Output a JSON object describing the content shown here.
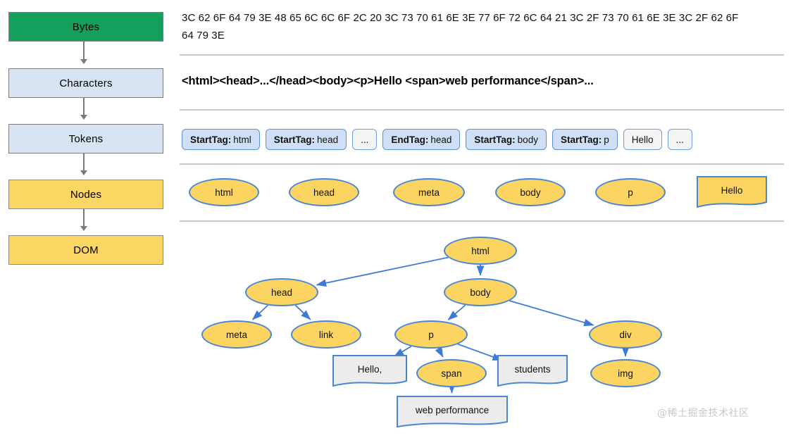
{
  "pipeline": {
    "steps": [
      {
        "label": "Bytes",
        "color": "#14A05C"
      },
      {
        "label": "Characters",
        "color": "#D7E3F1"
      },
      {
        "label": "Tokens",
        "color": "#D7E3F1"
      },
      {
        "label": "Nodes",
        "color": "#FBD662"
      },
      {
        "label": "DOM",
        "color": "#FBD662"
      }
    ]
  },
  "stages": {
    "bytes_hex": "3C 62 6F 64 79 3E 48 65 6C 6C 6F 2C 20 3C 73 70 61 6E 3E 77 6F 72 6C 64 21 3C 2F 73 70 61 6E 3E 3C 2F 62 6F 64 79 3E",
    "characters": "<html><head>...</head><body><p>Hello <span>web performance</span>...",
    "tokens": [
      {
        "kind": "StartTag",
        "value": "html",
        "plain": false
      },
      {
        "kind": "StartTag",
        "value": "head",
        "plain": false
      },
      {
        "kind": "",
        "value": "...",
        "plain": true
      },
      {
        "kind": "EndTag",
        "value": "head",
        "plain": false
      },
      {
        "kind": "StartTag",
        "value": "body",
        "plain": false
      },
      {
        "kind": "StartTag",
        "value": "p",
        "plain": false
      },
      {
        "kind": "",
        "value": "Hello",
        "plain": true
      },
      {
        "kind": "",
        "value": "...",
        "plain": true
      }
    ],
    "nodes": [
      {
        "label": "html",
        "shape": "ellipse"
      },
      {
        "label": "head",
        "shape": "ellipse"
      },
      {
        "label": "meta",
        "shape": "ellipse"
      },
      {
        "label": "body",
        "shape": "ellipse"
      },
      {
        "label": "p",
        "shape": "ellipse"
      },
      {
        "label": "Hello",
        "shape": "note"
      }
    ]
  },
  "dom_tree": {
    "nodes": [
      {
        "id": "html",
        "label": "html",
        "shape": "ellipse"
      },
      {
        "id": "head",
        "label": "head",
        "shape": "ellipse"
      },
      {
        "id": "body",
        "label": "body",
        "shape": "ellipse"
      },
      {
        "id": "meta",
        "label": "meta",
        "shape": "ellipse"
      },
      {
        "id": "link",
        "label": "link",
        "shape": "ellipse"
      },
      {
        "id": "p",
        "label": "p",
        "shape": "ellipse"
      },
      {
        "id": "div",
        "label": "div",
        "shape": "ellipse"
      },
      {
        "id": "hello",
        "label": "Hello,",
        "shape": "note"
      },
      {
        "id": "span",
        "label": "span",
        "shape": "ellipse"
      },
      {
        "id": "stud",
        "label": "students",
        "shape": "note"
      },
      {
        "id": "img",
        "label": "img",
        "shape": "ellipse"
      },
      {
        "id": "webperf",
        "label": "web performance",
        "shape": "note"
      }
    ],
    "edges": [
      [
        "html",
        "head"
      ],
      [
        "html",
        "body"
      ],
      [
        "head",
        "meta"
      ],
      [
        "head",
        "link"
      ],
      [
        "body",
        "p"
      ],
      [
        "body",
        "div"
      ],
      [
        "p",
        "hello"
      ],
      [
        "p",
        "span"
      ],
      [
        "p",
        "stud"
      ],
      [
        "div",
        "img"
      ],
      [
        "span",
        "webperf"
      ]
    ]
  },
  "watermark": "@稀土掘金技术社区",
  "colors": {
    "green": "#14A05C",
    "light_blue": "#D7E3F1",
    "yellow": "#FBD662",
    "node_stroke": "#4a86D8",
    "token_fill": "#CFE0F6",
    "note_fill": "#ECECEC",
    "arrow_gray": "#7a7a7a",
    "edge_blue": "#3D7BD9",
    "separator": "#c9c9c9"
  }
}
